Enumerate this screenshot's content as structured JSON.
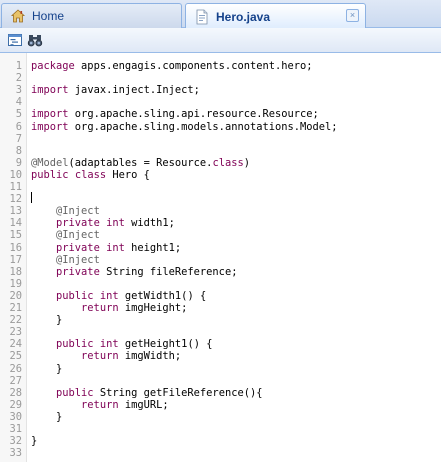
{
  "tabs": [
    {
      "label": "Home",
      "icon": "home-icon"
    },
    {
      "label": "Hero.java",
      "icon": "java-file-icon",
      "close_glyph": "×"
    }
  ],
  "toolbar": {
    "buttons": [
      {
        "icon": "format-code-icon"
      },
      {
        "icon": "find-binoculars-icon"
      }
    ]
  },
  "colors": {
    "keyword": "#7f0055",
    "annotation": "#646464",
    "tab_text": "#15428b",
    "line_number": "#999999"
  },
  "editor": {
    "lines": [
      {
        "num": "1",
        "tokens": [
          [
            "kw",
            "package"
          ],
          [
            "t",
            " apps.engagis.components.content.hero;"
          ]
        ]
      },
      {
        "num": "2",
        "tokens": []
      },
      {
        "num": "3",
        "tokens": [
          [
            "kw",
            "import"
          ],
          [
            "t",
            " javax.inject.Inject;"
          ]
        ]
      },
      {
        "num": "4",
        "tokens": []
      },
      {
        "num": "5",
        "tokens": [
          [
            "kw",
            "import"
          ],
          [
            "t",
            " org.apache.sling.api.resource.Resource;"
          ]
        ]
      },
      {
        "num": "6",
        "tokens": [
          [
            "kw",
            "import"
          ],
          [
            "t",
            " org.apache.sling.models.annotations.Model;"
          ]
        ]
      },
      {
        "num": "7",
        "tokens": []
      },
      {
        "num": "8",
        "tokens": []
      },
      {
        "num": "9",
        "tokens": [
          [
            "ann",
            "@Model"
          ],
          [
            "t",
            "(adaptables = Resource."
          ],
          [
            "kw",
            "class"
          ],
          [
            "t",
            ")"
          ]
        ]
      },
      {
        "num": "10",
        "tokens": [
          [
            "kw",
            "public"
          ],
          [
            "t",
            " "
          ],
          [
            "kw",
            "class"
          ],
          [
            "t",
            " Hero {"
          ]
        ]
      },
      {
        "num": "11",
        "tokens": []
      },
      {
        "num": "12",
        "tokens": []
      },
      {
        "num": "13",
        "tokens": [
          [
            "t",
            "    "
          ],
          [
            "ann",
            "@Inject"
          ]
        ]
      },
      {
        "num": "14",
        "tokens": [
          [
            "t",
            "    "
          ],
          [
            "kw",
            "private"
          ],
          [
            "t",
            " "
          ],
          [
            "kw",
            "int"
          ],
          [
            "t",
            " width1;"
          ]
        ]
      },
      {
        "num": "15",
        "tokens": [
          [
            "t",
            "    "
          ],
          [
            "ann",
            "@Inject"
          ]
        ]
      },
      {
        "num": "16",
        "tokens": [
          [
            "t",
            "    "
          ],
          [
            "kw",
            "private"
          ],
          [
            "t",
            " "
          ],
          [
            "kw",
            "int"
          ],
          [
            "t",
            " height1;"
          ]
        ]
      },
      {
        "num": "17",
        "tokens": [
          [
            "t",
            "    "
          ],
          [
            "ann",
            "@Inject"
          ]
        ]
      },
      {
        "num": "18",
        "tokens": [
          [
            "t",
            "    "
          ],
          [
            "kw",
            "private"
          ],
          [
            "t",
            " String fileReference;"
          ]
        ]
      },
      {
        "num": "19",
        "tokens": []
      },
      {
        "num": "20",
        "tokens": [
          [
            "t",
            "    "
          ],
          [
            "kw",
            "public"
          ],
          [
            "t",
            " "
          ],
          [
            "kw",
            "int"
          ],
          [
            "t",
            " getWidth1() {"
          ]
        ]
      },
      {
        "num": "21",
        "tokens": [
          [
            "t",
            "        "
          ],
          [
            "kw",
            "return"
          ],
          [
            "t",
            " imgHeight;"
          ]
        ]
      },
      {
        "num": "22",
        "tokens": [
          [
            "t",
            "    }"
          ]
        ]
      },
      {
        "num": "23",
        "tokens": []
      },
      {
        "num": "24",
        "tokens": [
          [
            "t",
            "    "
          ],
          [
            "kw",
            "public"
          ],
          [
            "t",
            " "
          ],
          [
            "kw",
            "int"
          ],
          [
            "t",
            " getHeight1() {"
          ]
        ]
      },
      {
        "num": "25",
        "tokens": [
          [
            "t",
            "        "
          ],
          [
            "kw",
            "return"
          ],
          [
            "t",
            " imgWidth;"
          ]
        ]
      },
      {
        "num": "26",
        "tokens": [
          [
            "t",
            "    }"
          ]
        ]
      },
      {
        "num": "27",
        "tokens": []
      },
      {
        "num": "28",
        "tokens": [
          [
            "t",
            "    "
          ],
          [
            "kw",
            "public"
          ],
          [
            "t",
            " String getFileReference(){"
          ]
        ]
      },
      {
        "num": "29",
        "tokens": [
          [
            "t",
            "        "
          ],
          [
            "kw",
            "return"
          ],
          [
            "t",
            " imgURL;"
          ]
        ]
      },
      {
        "num": "30",
        "tokens": [
          [
            "t",
            "    }"
          ]
        ]
      },
      {
        "num": "31",
        "tokens": []
      },
      {
        "num": "32",
        "tokens": [
          [
            "t",
            "}"
          ]
        ]
      },
      {
        "num": "33",
        "tokens": []
      }
    ]
  }
}
